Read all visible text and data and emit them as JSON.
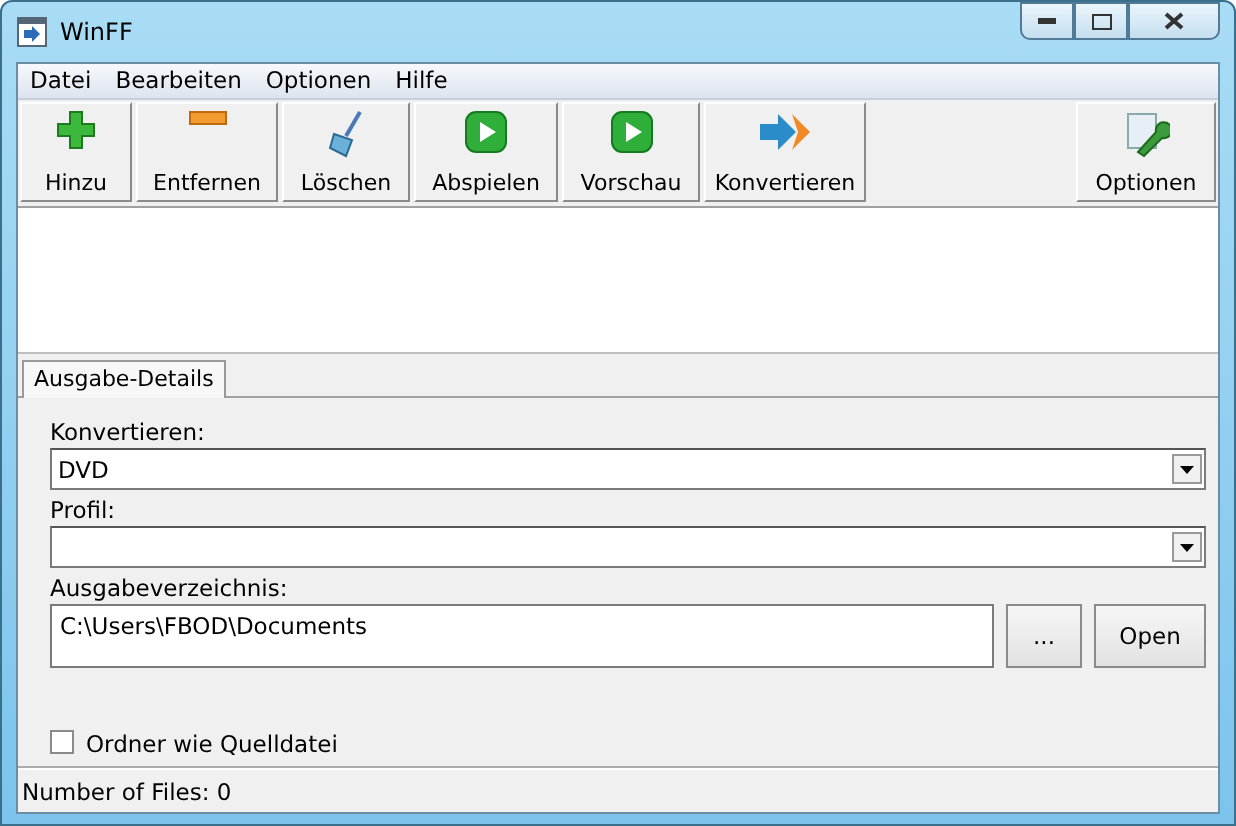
{
  "window": {
    "title": "WinFF"
  },
  "menu": [
    "Datei",
    "Bearbeiten",
    "Optionen",
    "Hilfe"
  ],
  "toolbar": [
    {
      "kind": "add",
      "label": "Hinzu"
    },
    {
      "kind": "remove",
      "label": "Entfernen"
    },
    {
      "kind": "clear",
      "label": "Löschen"
    },
    {
      "kind": "play",
      "label": "Abspielen"
    },
    {
      "kind": "play",
      "label": "Vorschau"
    },
    {
      "kind": "convert",
      "label": "Konvertieren"
    },
    {
      "kind": "options",
      "label": "Optionen"
    }
  ],
  "tabs": [
    {
      "label": "Ausgabe-Details",
      "selected": true
    }
  ],
  "convert": {
    "label": "Konvertieren:",
    "value": "DVD"
  },
  "profile": {
    "label": "Profil:"
  },
  "output_dir": {
    "label": "Ausgabeverzeichnis:",
    "value": "C:\\Users\\FBOD\\Documents",
    "browse_button": "...",
    "open_button": "Open"
  },
  "same_folder": {
    "label": "Ordner wie Quelldatei",
    "checked": false
  },
  "status_bar": "Number of Files: 0"
}
